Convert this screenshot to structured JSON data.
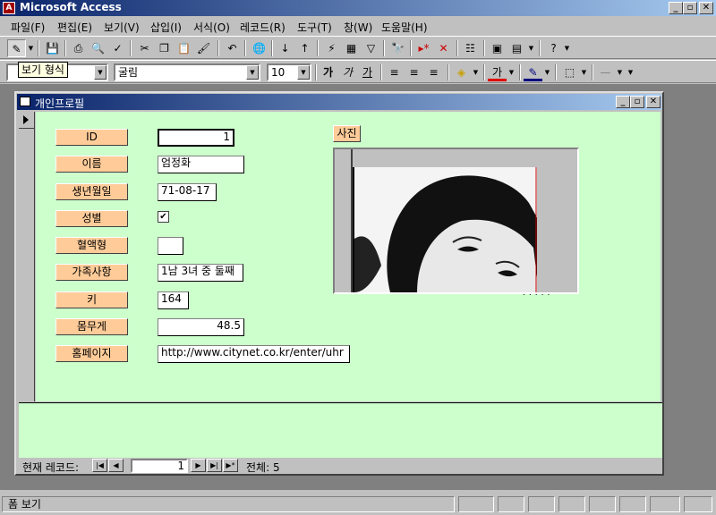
{
  "app": {
    "title": "Microsoft Access"
  },
  "menu": [
    "파일(F)",
    "편집(E)",
    "보기(V)",
    "삽입(I)",
    "서식(O)",
    "레코드(R)",
    "도구(T)",
    "창(W)",
    "도움말(H)"
  ],
  "formatting": {
    "font_name": "굴림",
    "font_size": "10",
    "bold_icon": "가",
    "italic_icon": "가",
    "underline_icon": "가",
    "font_color_icon": "가"
  },
  "tooltip": "보기 형식",
  "form": {
    "title": "개인프로필",
    "fields": [
      {
        "label": "ID",
        "value": "1"
      },
      {
        "label": "이름",
        "value": "엄정화"
      },
      {
        "label": "생년월일",
        "value": "71-08-17"
      },
      {
        "label": "성별",
        "value": "✔"
      },
      {
        "label": "혈액형",
        "value": ""
      },
      {
        "label": "가족사항",
        "value": "1남 3녀 중 둘째"
      },
      {
        "label": "키",
        "value": "164"
      },
      {
        "label": "몸무게",
        "value": "48.5"
      },
      {
        "label": "홈페이지",
        "value": "http://www.citynet.co.kr/enter/uhr"
      }
    ],
    "photo_label": "사진"
  },
  "navigation": {
    "label": "현재 레코드:",
    "current": "1",
    "total_label": "전체: 5"
  },
  "status": {
    "text": "폼 보기"
  }
}
